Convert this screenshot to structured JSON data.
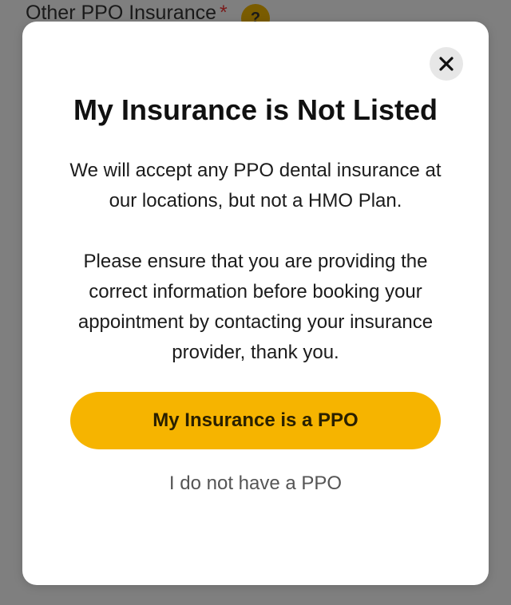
{
  "background": {
    "field_label": "Other PPO Insurance",
    "required_mark": "*",
    "help_label": "?"
  },
  "modal": {
    "title": "My Insurance is Not Listed",
    "paragraphs": [
      "We will accept any PPO dental insurance at our locations, but not a HMO Plan.",
      "Please ensure that you are providing the correct information before booking your appointment by contacting your insurance provider, thank you."
    ],
    "primary_button": "My Insurance is a PPO",
    "secondary_link": "I do not have a PPO"
  },
  "colors": {
    "overlay": "#7f7f7f",
    "accent": "#f6b400",
    "modal_bg": "#ffffff",
    "close_bg": "#e7e7e7"
  },
  "icons": {
    "close": "close-icon",
    "help": "help-icon"
  }
}
